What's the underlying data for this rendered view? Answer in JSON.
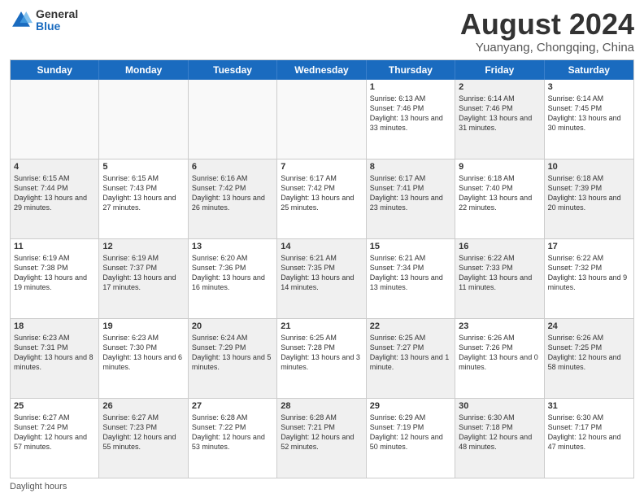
{
  "header": {
    "logo_general": "General",
    "logo_blue": "Blue",
    "month_title": "August 2024",
    "subtitle": "Yuanyang, Chongqing, China"
  },
  "days_of_week": [
    "Sunday",
    "Monday",
    "Tuesday",
    "Wednesday",
    "Thursday",
    "Friday",
    "Saturday"
  ],
  "weeks": [
    [
      {
        "day": "",
        "info": "",
        "empty": true
      },
      {
        "day": "",
        "info": "",
        "empty": true
      },
      {
        "day": "",
        "info": "",
        "empty": true
      },
      {
        "day": "",
        "info": "",
        "empty": true
      },
      {
        "day": "1",
        "info": "Sunrise: 6:13 AM\nSunset: 7:46 PM\nDaylight: 13 hours\nand 33 minutes."
      },
      {
        "day": "2",
        "info": "Sunrise: 6:14 AM\nSunset: 7:46 PM\nDaylight: 13 hours\nand 31 minutes.",
        "shaded": true
      },
      {
        "day": "3",
        "info": "Sunrise: 6:14 AM\nSunset: 7:45 PM\nDaylight: 13 hours\nand 30 minutes."
      }
    ],
    [
      {
        "day": "4",
        "info": "Sunrise: 6:15 AM\nSunset: 7:44 PM\nDaylight: 13 hours\nand 29 minutes.",
        "shaded": true
      },
      {
        "day": "5",
        "info": "Sunrise: 6:15 AM\nSunset: 7:43 PM\nDaylight: 13 hours\nand 27 minutes."
      },
      {
        "day": "6",
        "info": "Sunrise: 6:16 AM\nSunset: 7:42 PM\nDaylight: 13 hours\nand 26 minutes.",
        "shaded": true
      },
      {
        "day": "7",
        "info": "Sunrise: 6:17 AM\nSunset: 7:42 PM\nDaylight: 13 hours\nand 25 minutes."
      },
      {
        "day": "8",
        "info": "Sunrise: 6:17 AM\nSunset: 7:41 PM\nDaylight: 13 hours\nand 23 minutes.",
        "shaded": true
      },
      {
        "day": "9",
        "info": "Sunrise: 6:18 AM\nSunset: 7:40 PM\nDaylight: 13 hours\nand 22 minutes."
      },
      {
        "day": "10",
        "info": "Sunrise: 6:18 AM\nSunset: 7:39 PM\nDaylight: 13 hours\nand 20 minutes.",
        "shaded": true
      }
    ],
    [
      {
        "day": "11",
        "info": "Sunrise: 6:19 AM\nSunset: 7:38 PM\nDaylight: 13 hours\nand 19 minutes."
      },
      {
        "day": "12",
        "info": "Sunrise: 6:19 AM\nSunset: 7:37 PM\nDaylight: 13 hours\nand 17 minutes.",
        "shaded": true
      },
      {
        "day": "13",
        "info": "Sunrise: 6:20 AM\nSunset: 7:36 PM\nDaylight: 13 hours\nand 16 minutes."
      },
      {
        "day": "14",
        "info": "Sunrise: 6:21 AM\nSunset: 7:35 PM\nDaylight: 13 hours\nand 14 minutes.",
        "shaded": true
      },
      {
        "day": "15",
        "info": "Sunrise: 6:21 AM\nSunset: 7:34 PM\nDaylight: 13 hours\nand 13 minutes."
      },
      {
        "day": "16",
        "info": "Sunrise: 6:22 AM\nSunset: 7:33 PM\nDaylight: 13 hours\nand 11 minutes.",
        "shaded": true
      },
      {
        "day": "17",
        "info": "Sunrise: 6:22 AM\nSunset: 7:32 PM\nDaylight: 13 hours\nand 9 minutes."
      }
    ],
    [
      {
        "day": "18",
        "info": "Sunrise: 6:23 AM\nSunset: 7:31 PM\nDaylight: 13 hours\nand 8 minutes.",
        "shaded": true
      },
      {
        "day": "19",
        "info": "Sunrise: 6:23 AM\nSunset: 7:30 PM\nDaylight: 13 hours\nand 6 minutes."
      },
      {
        "day": "20",
        "info": "Sunrise: 6:24 AM\nSunset: 7:29 PM\nDaylight: 13 hours\nand 5 minutes.",
        "shaded": true
      },
      {
        "day": "21",
        "info": "Sunrise: 6:25 AM\nSunset: 7:28 PM\nDaylight: 13 hours\nand 3 minutes."
      },
      {
        "day": "22",
        "info": "Sunrise: 6:25 AM\nSunset: 7:27 PM\nDaylight: 13 hours\nand 1 minute.",
        "shaded": true
      },
      {
        "day": "23",
        "info": "Sunrise: 6:26 AM\nSunset: 7:26 PM\nDaylight: 13 hours\nand 0 minutes."
      },
      {
        "day": "24",
        "info": "Sunrise: 6:26 AM\nSunset: 7:25 PM\nDaylight: 12 hours\nand 58 minutes.",
        "shaded": true
      }
    ],
    [
      {
        "day": "25",
        "info": "Sunrise: 6:27 AM\nSunset: 7:24 PM\nDaylight: 12 hours\nand 57 minutes."
      },
      {
        "day": "26",
        "info": "Sunrise: 6:27 AM\nSunset: 7:23 PM\nDaylight: 12 hours\nand 55 minutes.",
        "shaded": true
      },
      {
        "day": "27",
        "info": "Sunrise: 6:28 AM\nSunset: 7:22 PM\nDaylight: 12 hours\nand 53 minutes."
      },
      {
        "day": "28",
        "info": "Sunrise: 6:28 AM\nSunset: 7:21 PM\nDaylight: 12 hours\nand 52 minutes.",
        "shaded": true
      },
      {
        "day": "29",
        "info": "Sunrise: 6:29 AM\nSunset: 7:19 PM\nDaylight: 12 hours\nand 50 minutes."
      },
      {
        "day": "30",
        "info": "Sunrise: 6:30 AM\nSunset: 7:18 PM\nDaylight: 12 hours\nand 48 minutes.",
        "shaded": true
      },
      {
        "day": "31",
        "info": "Sunrise: 6:30 AM\nSunset: 7:17 PM\nDaylight: 12 hours\nand 47 minutes."
      }
    ]
  ],
  "footer": {
    "label": "Daylight hours"
  }
}
